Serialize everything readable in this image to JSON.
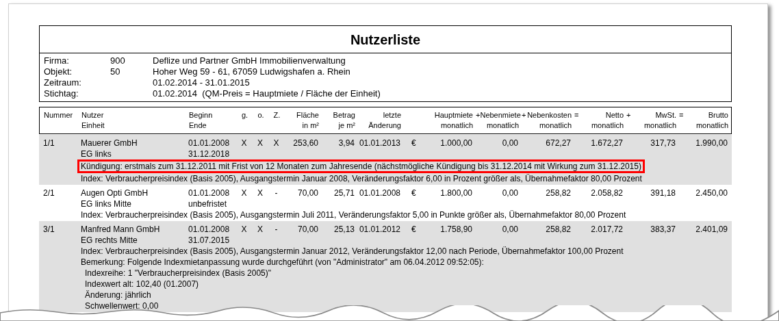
{
  "title": "Nutzerliste",
  "info": [
    {
      "label": "Firma:",
      "number": "900",
      "text": "Deflize und Partner GmbH Immobilienverwaltung"
    },
    {
      "label": "Objekt:",
      "number": "50",
      "text": "Hoher Weg 59 - 61, 67059 Ludwigshafen a. Rhein"
    },
    {
      "label": "Zeitraum:",
      "text": "01.02.2014 - 31.01.2015"
    },
    {
      "label": "Stichtag:",
      "text": "01.02.2014  (QM-Preis = Hauptmiete / Fläche der Einheit)"
    }
  ],
  "columns": [
    {
      "line1": "Nummer"
    },
    {
      "line1": "Nutzer",
      "line2": "Einheit"
    },
    {
      "line1": "Beginn",
      "line2": "Ende"
    },
    {
      "line1": "g."
    },
    {
      "line1": "o."
    },
    {
      "line1": "Z."
    },
    {
      "line1": "Fläche",
      "line2": "in m²"
    },
    {
      "line1": "Betrag",
      "line2": "je m²"
    },
    {
      "line1": "letzte",
      "line2": "Änderung"
    },
    {},
    {
      "line1": "Hauptmiete",
      "line2": "monatlich"
    },
    {
      "operator": "+",
      "line1": "Nebenmiete",
      "line2": "monatlich"
    },
    {
      "operator": "+",
      "line1": "Nebenkosten",
      "line2": "monatlich"
    },
    {
      "operator": "=",
      "line1": "Netto",
      "line2": "monatlich"
    },
    {
      "operator": "+",
      "line1": "MwSt.",
      "line2": "monatlich"
    },
    {
      "operator": "=",
      "line1": "Brutto",
      "line2": "monatlich"
    }
  ],
  "rows": [
    {
      "shaded": true,
      "cells": [
        "1/1",
        "Mauerer GmbH",
        "01.01.2008",
        "X",
        "X",
        "X",
        "253,60",
        "3,94",
        "01.01.2013",
        "€",
        "1.000,00",
        "0,00",
        "672,27",
        "1.672,27",
        "317,73",
        "1.990,00"
      ],
      "unit": "EG links",
      "end": "31.12.2018",
      "notes": [
        {
          "text": "Kündigung: erstmals zum 31.12.2011 mit Frist von 12 Monaten zum Jahresende (nächstmögliche Kündigung bis 31.12.2014 mit Wirkung zum 31.12.2015)",
          "highlighted": true
        },
        {
          "text": "Index: Verbraucherpreisindex (Basis 2005), Ausgangstermin Januar 2008, Veränderungsfaktor 6,00 in Prozent größer als, Übernahmefaktor 80,00 Prozent",
          "highlighted": false
        }
      ]
    },
    {
      "shaded": false,
      "cells": [
        "2/1",
        "Augen Opti GmbH",
        "01.01.2008",
        "X",
        "X",
        "-",
        "70,00",
        "25,71",
        "01.01.2008",
        "€",
        "1.800,00",
        "0,00",
        "258,82",
        "2.058,82",
        "391,18",
        "2.450,00"
      ],
      "unit": "EG links Mitte",
      "end": "unbefristet",
      "notes": [
        {
          "text": "Index: Verbraucherpreisindex (Basis 2005), Ausgangstermin Juli 2011, Veränderungsfaktor 5,00 in Punkte größer als, Übernahmefaktor 80,00 Prozent",
          "highlighted": false
        }
      ]
    },
    {
      "shaded": true,
      "cells": [
        "3/1",
        "Manfred Mann GmbH",
        "01.01.2008",
        "X",
        "X",
        "-",
        "70,00",
        "25,13",
        "01.01.2012",
        "€",
        "1.758,90",
        "0,00",
        "258,82",
        "2.017,72",
        "383,37",
        "2.401,09"
      ],
      "unit": "EG rechts Mitte",
      "end": "31.07.2015",
      "notes": [
        {
          "text": "Index: Verbraucherpreisindex (Basis 2005), Ausgangstermin Januar 2012, Veränderungsfaktor 12,00 nach Periode, Übernahmefaktor 100,00 Prozent",
          "highlighted": false
        },
        {
          "text": "Bemerkung: Folgende Indexmietanpassung wurde durchgeführt (von \"Administrator\" am 06.04.2012 09:52:05):",
          "highlighted": false,
          "children": [
            {
              "text": "Indexreihe: 1 \"Verbraucherpreisindex (Basis 2005)\"",
              "highlighted": false
            },
            {
              "text": "Indexwert alt: 102,40 (01.2007)",
              "highlighted": false
            },
            {
              "text": "Änderung: jährlich",
              "highlighted": false
            },
            {
              "text": "Schwellenwert: 0,00",
              "highlighted": false
            }
          ]
        }
      ]
    }
  ]
}
